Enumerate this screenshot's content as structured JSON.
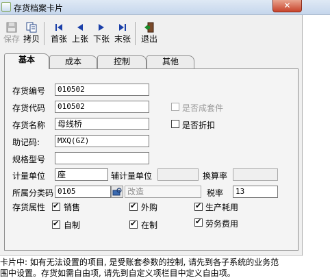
{
  "window": {
    "title": "存货档案卡片"
  },
  "toolbar": {
    "save": "保存",
    "copy": "拷贝",
    "first": "首张",
    "prev": "上张",
    "next": "下张",
    "last": "末张",
    "exit": "退出"
  },
  "tabs": [
    "基本",
    "成本",
    "控制",
    "其他"
  ],
  "form": {
    "inv_no_label": "存货编号",
    "inv_no_value": "010502",
    "inv_code_label": "存货代码",
    "inv_code_value": "010502",
    "inv_name_label": "存货名称",
    "inv_name_value": "母线桥",
    "mnemonic_label": "助记码:",
    "mnemonic_value": "MXQ(GZ)",
    "spec_label": "规格型号",
    "spec_value": "",
    "unit_label": "计量单位",
    "unit_value": "座",
    "aux_unit_label": "辅计量单位",
    "aux_unit_value": "",
    "rate_label": "换算率",
    "rate_value": "",
    "category_label": "所属分类码",
    "category_code": "0105",
    "category_name": "改造",
    "tax_label": "税率",
    "tax_value": "13",
    "attr_label": "存货属性",
    "is_kit_label": "是否成套件",
    "is_discount_label": "是否折扣",
    "sales_label": "销售",
    "purchase_label": "外购",
    "production_label": "生产耗用",
    "self_made_label": "自制",
    "in_process_label": "在制",
    "labor_label": "劳务费用"
  },
  "checks": {
    "is_kit": false,
    "is_discount": false,
    "sales": true,
    "purchase": true,
    "production": true,
    "self_made": true,
    "in_process": true,
    "labor": true
  },
  "footer": {
    "line1": "卡片中: 如有无法设置的项目, 是受账套参数的控制, 请先到各子系统的业务范",
    "line2": "围中设置。存货如需自由项, 请先到自定义项栏目中定义自由项。"
  }
}
